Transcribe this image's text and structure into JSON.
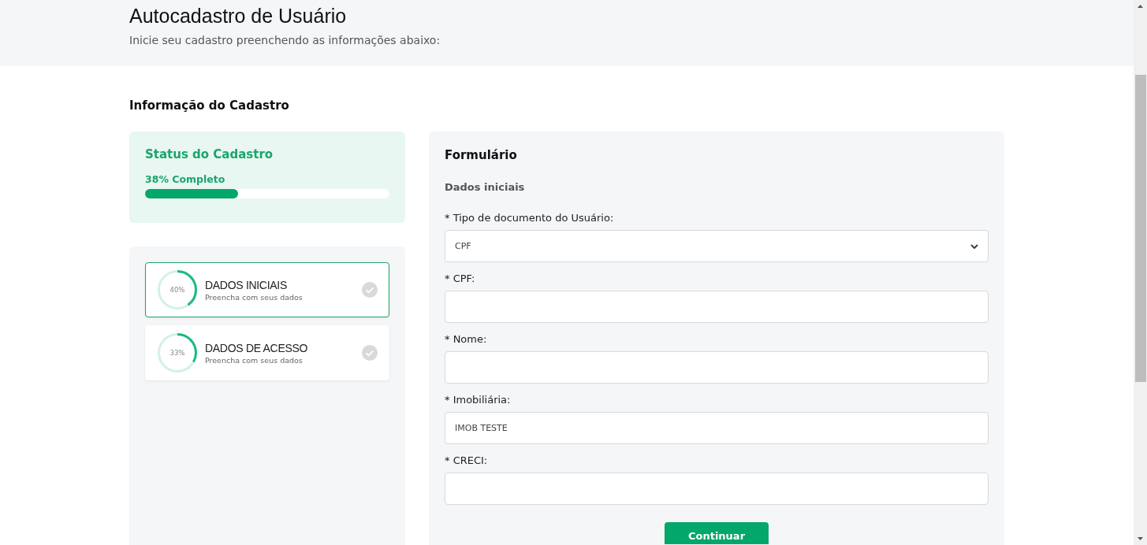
{
  "header": {
    "title": "Autocadastro de Usuário",
    "subtitle": "Inicie seu cadastro preenchendo as informações abaixo:"
  },
  "section_title": "Informação do Cadastro",
  "status": {
    "title": "Status do Cadastro",
    "progress_text": "38% Completo",
    "level": 0.38
  },
  "steps": [
    {
      "percent": "40%",
      "level": 0.4,
      "title": "DADOS INICIAIS",
      "subtitle": "Preencha com seus dados",
      "selected": true,
      "done": false
    },
    {
      "percent": "33%",
      "level": 0.33,
      "title": "DADOS DE ACESSO",
      "subtitle": "Preencha com seus dados",
      "selected": false,
      "done": false
    }
  ],
  "form": {
    "title": "Formulário",
    "subtitle": "Dados iniciais",
    "fields": [
      {
        "kind": "select",
        "label": "* Tipo de documento do Usuário:",
        "value": "CPF"
      },
      {
        "kind": "text",
        "label": "* CPF:"
      },
      {
        "kind": "text",
        "label": "* Nome:"
      },
      {
        "kind": "text",
        "label": "* Imobiliária:",
        "value": "IMOB TESTE"
      },
      {
        "kind": "text",
        "label": "* CRECI:"
      }
    ],
    "button": "Continuar"
  }
}
